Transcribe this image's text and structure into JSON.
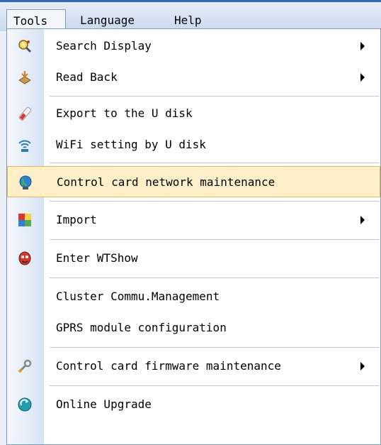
{
  "menubar": {
    "items": [
      {
        "label": "Tools"
      },
      {
        "label": "Language"
      },
      {
        "label": "Help"
      }
    ]
  },
  "menu": {
    "items": [
      {
        "label": "Search Display",
        "icon": "search-display-icon",
        "submenu": true
      },
      {
        "label": "Read Back",
        "icon": "read-back-icon",
        "submenu": true
      },
      {
        "label": "Export to the U disk",
        "icon": "usb-export-icon",
        "submenu": false
      },
      {
        "label": "WiFi setting by U disk",
        "icon": "wifi-icon",
        "submenu": false
      },
      {
        "label": "Control card network maintenance",
        "icon": "globe-icon",
        "submenu": false,
        "highlighted": true
      },
      {
        "label": "Import",
        "icon": "import-icon",
        "submenu": true
      },
      {
        "label": "Enter WTShow",
        "icon": "wtshow-icon",
        "submenu": false
      },
      {
        "label": "Cluster Commu.Management",
        "icon": "",
        "submenu": false
      },
      {
        "label": "GPRS module configuration",
        "icon": "",
        "submenu": false
      },
      {
        "label": "Control card firmware maintenance",
        "icon": "wrench-icon",
        "submenu": true
      },
      {
        "label": "Online Upgrade",
        "icon": "online-upgrade-icon",
        "submenu": false
      }
    ]
  },
  "colors": {
    "highlight_bg": "#fdf0c8",
    "highlight_border": "#e3b55c",
    "menubar_top": "#2e68c0"
  }
}
